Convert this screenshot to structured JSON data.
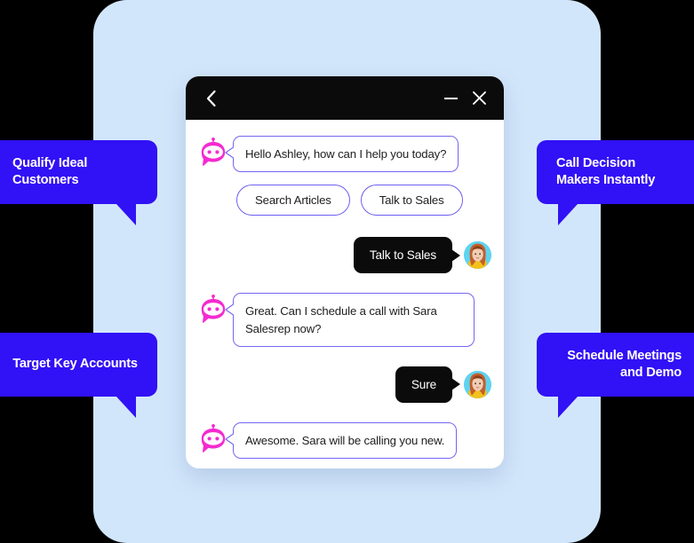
{
  "backdrop": {
    "color": "#d2e6fb"
  },
  "chat_window": {
    "header": {
      "back_icon": "chevron-left-icon",
      "minimize_icon": "minimize-icon",
      "close_icon": "close-icon",
      "background": "#0b0b0b"
    },
    "accent_border": "#7366f0",
    "bot_avatar_color": "#f52ad0",
    "messages": [
      {
        "id": "msg-bot-greeting",
        "sender": "bot",
        "text": "Hello Ashley, how can I help you today?"
      },
      {
        "id": "msg-user-talk-to-sales",
        "sender": "user",
        "text": "Talk to Sales"
      },
      {
        "id": "msg-bot-schedule",
        "sender": "bot",
        "text": "Great. Can I schedule a call with Sara Salesrep now?"
      },
      {
        "id": "msg-user-sure",
        "sender": "user",
        "text": "Sure"
      },
      {
        "id": "msg-bot-awesome",
        "sender": "bot",
        "text": "Awesome. Sara will be calling you new."
      }
    ],
    "quick_replies": [
      {
        "id": "quick-search-articles",
        "label": "Search Articles"
      },
      {
        "id": "quick-talk-to-sales",
        "label": "Talk to Sales"
      }
    ]
  },
  "callouts": {
    "color": "#3111f5",
    "items": [
      {
        "id": "callout-qualify",
        "text": "Qualify Ideal Customers",
        "side": "left",
        "align": "left"
      },
      {
        "id": "callout-target",
        "text": "Target Key Accounts",
        "side": "left",
        "align": "center"
      },
      {
        "id": "callout-call",
        "text": "Call Decision Makers Instantly",
        "side": "right",
        "align": "left"
      },
      {
        "id": "callout-schedule",
        "text": "Schedule Meetings and Demo",
        "side": "right",
        "align": "right"
      }
    ]
  }
}
